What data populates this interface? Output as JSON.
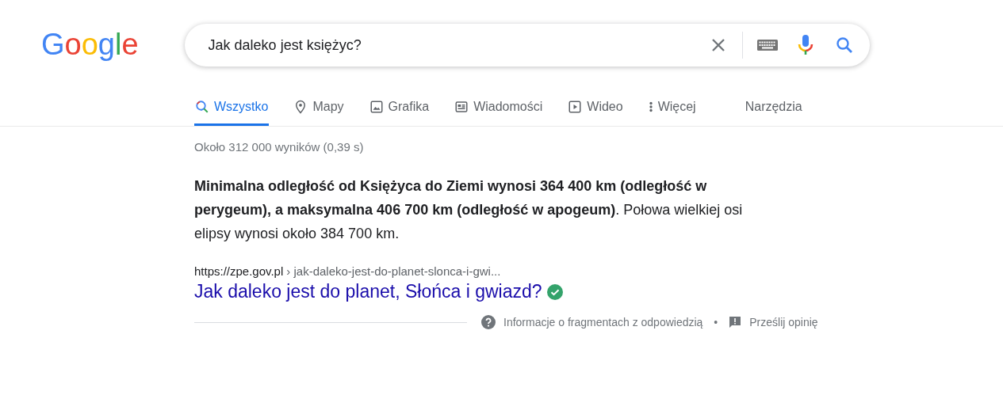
{
  "logo": "Google",
  "search": {
    "value": "Jak daleko jest księżyc?"
  },
  "tabs": [
    {
      "label": "Wszystko",
      "kind": "search",
      "selected": true
    },
    {
      "label": "Mapy",
      "kind": "pin",
      "selected": false
    },
    {
      "label": "Grafika",
      "kind": "image",
      "selected": false
    },
    {
      "label": "Wiadomości",
      "kind": "news",
      "selected": false
    },
    {
      "label": "Wideo",
      "kind": "video",
      "selected": false
    },
    {
      "label": "Więcej",
      "kind": "more",
      "selected": false
    }
  ],
  "tools": "Narzędzia",
  "result_stats": "Około 312 000 wyników (0,39 s)",
  "snippet": "**Minimalna odległość od Księżyca do Ziemi wynosi 364 400 km (odległość w perygeum), a maksymalna 406 700 km (odległość w apogeum)**. Połowa wielkiej osi elipsy wynosi około 384 700 km.",
  "result": {
    "domain": "https://zpe.gov.pl",
    "path": "› jak-daleko-jest-do-planet-slonca-i-gwi...",
    "title": "Jak daleko jest do planet, Słońca i gwiazd?",
    "verified": true
  },
  "footer": {
    "about": "Informacje o fragmentach z odpowiedzią",
    "separator": "•",
    "feedback": "Prześlij opinię"
  }
}
